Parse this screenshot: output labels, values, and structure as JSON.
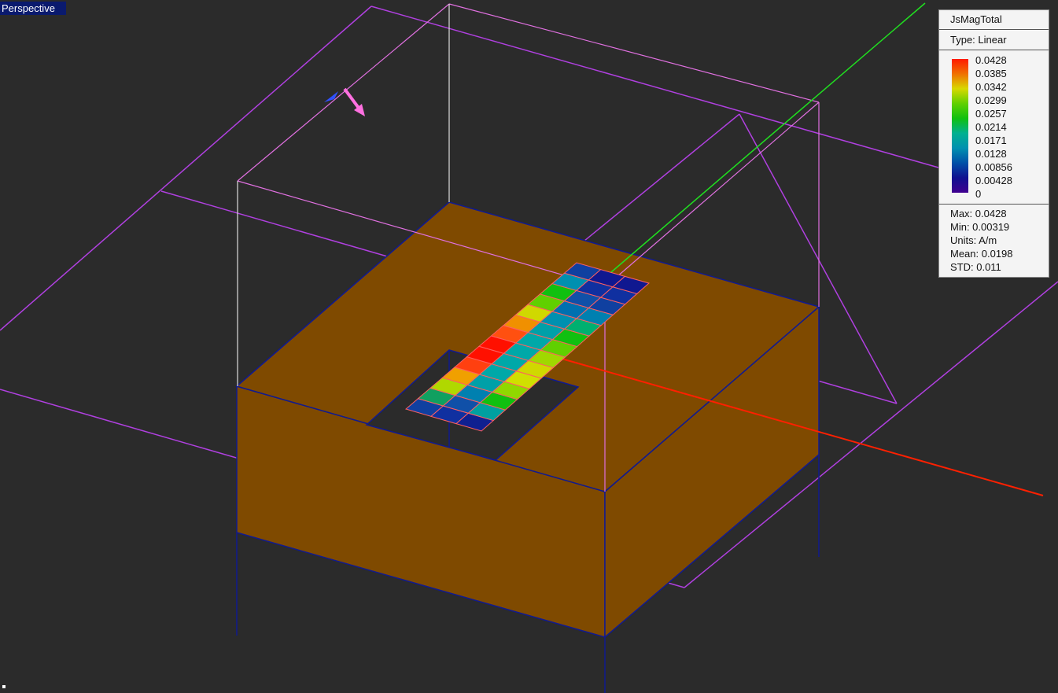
{
  "viewport": {
    "label": "Perspective"
  },
  "legend": {
    "title": "JsMagTotal",
    "type": "Type: Linear",
    "ticks": [
      "0.0428",
      "0.0385",
      "0.0342",
      "0.0299",
      "0.0257",
      "0.0214",
      "0.0171",
      "0.0128",
      "0.00856",
      "0.00428",
      "0"
    ],
    "stats": [
      "Max: 0.0428",
      "Min: 0.00319",
      "Units: A/m",
      "Mean: 0.0198",
      "STD: 0.011"
    ]
  },
  "colors": {
    "body": "#7f4a00",
    "background": "#2b2b2b",
    "x_axis": "#ff2000",
    "y_axis": "#20e020",
    "region": "#c040e0"
  }
}
